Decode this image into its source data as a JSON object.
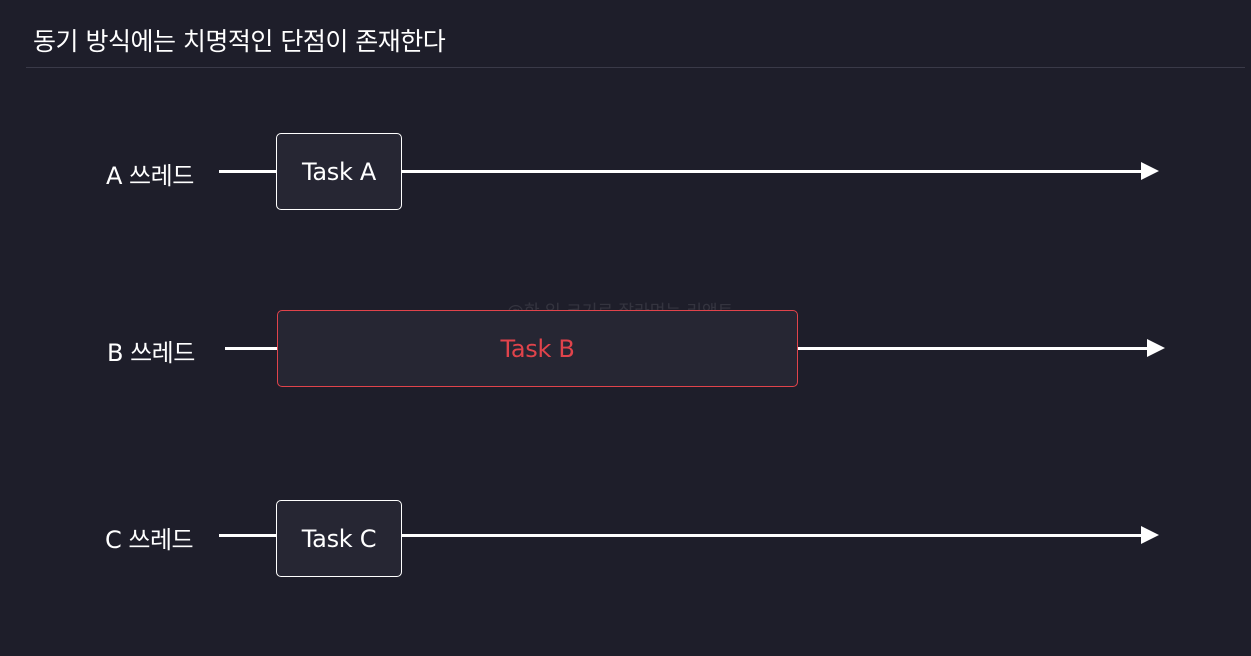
{
  "title": "동기 방식에는 치명적인 단점이 존재한다",
  "watermark": "@한 입 크기로 잘라먹는 리액트",
  "colors": {
    "background": "#1e1e2a",
    "line": "#ffffff",
    "task_border": "#ffffff",
    "blocking_task": "#e0434b"
  },
  "threads": [
    {
      "label": "A 쓰레드",
      "task": "Task A"
    },
    {
      "label": "B 쓰레드",
      "task": "Task B"
    },
    {
      "label": "C 쓰레드",
      "task": "Task C"
    }
  ]
}
